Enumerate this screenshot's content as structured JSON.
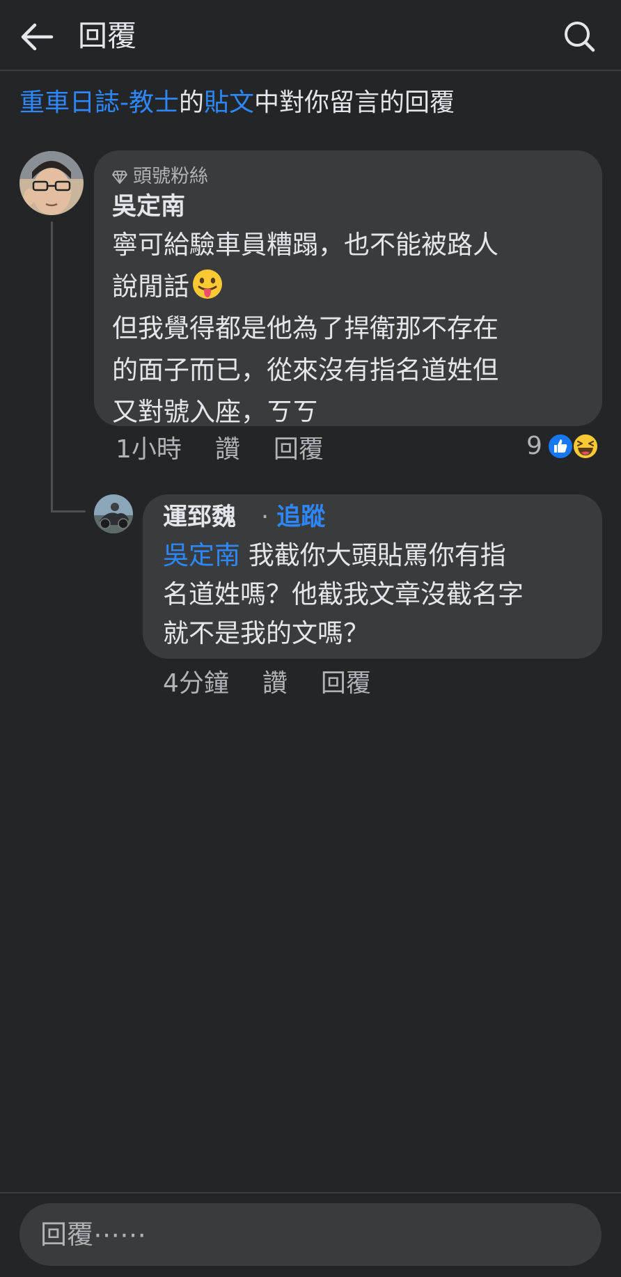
{
  "header": {
    "title": "回覆",
    "back_icon": "arrow-left-icon",
    "search_icon": "search-icon"
  },
  "context": {
    "page_name": "重車日誌-教士",
    "of": "的",
    "post": "貼文",
    "rest": "中對你留言的回覆"
  },
  "comments": [
    {
      "badge": "頭號粉絲",
      "badge_icon": "diamond-icon",
      "author": "吳定南",
      "lines": [
        "寧可給驗車員糟蹋，也不能被路人",
        "說閒話",
        "但我覺得都是他為了捍衛那不存在",
        "的面子而已，從來沒有指名道姓但",
        "又對號入座，ㄎㄎ"
      ],
      "emoji": "tongue-out-emoji",
      "time": "1小時",
      "like_label": "讚",
      "reply_label": "回覆",
      "reaction_count": "9",
      "reaction_icons": [
        "like-reaction-icon",
        "haha-reaction-icon"
      ]
    },
    {
      "author": "運郅魏",
      "dot": "·",
      "follow_label": "追蹤",
      "mention": "吳定南",
      "lines": [
        " 我截你大頭貼罵你有指",
        "名道姓嗎？他截我文章沒截名字",
        "就不是我的文嗎？"
      ],
      "time": "4分鐘",
      "like_label": "讚",
      "reply_label": "回覆"
    }
  ],
  "composer": {
    "placeholder": "回覆⋯⋯"
  },
  "colors": {
    "background": "#242527",
    "bubble": "#3a3b3c",
    "link": "#2d88ff",
    "muted": "#b0b3b8",
    "text": "#e4e6eb"
  }
}
